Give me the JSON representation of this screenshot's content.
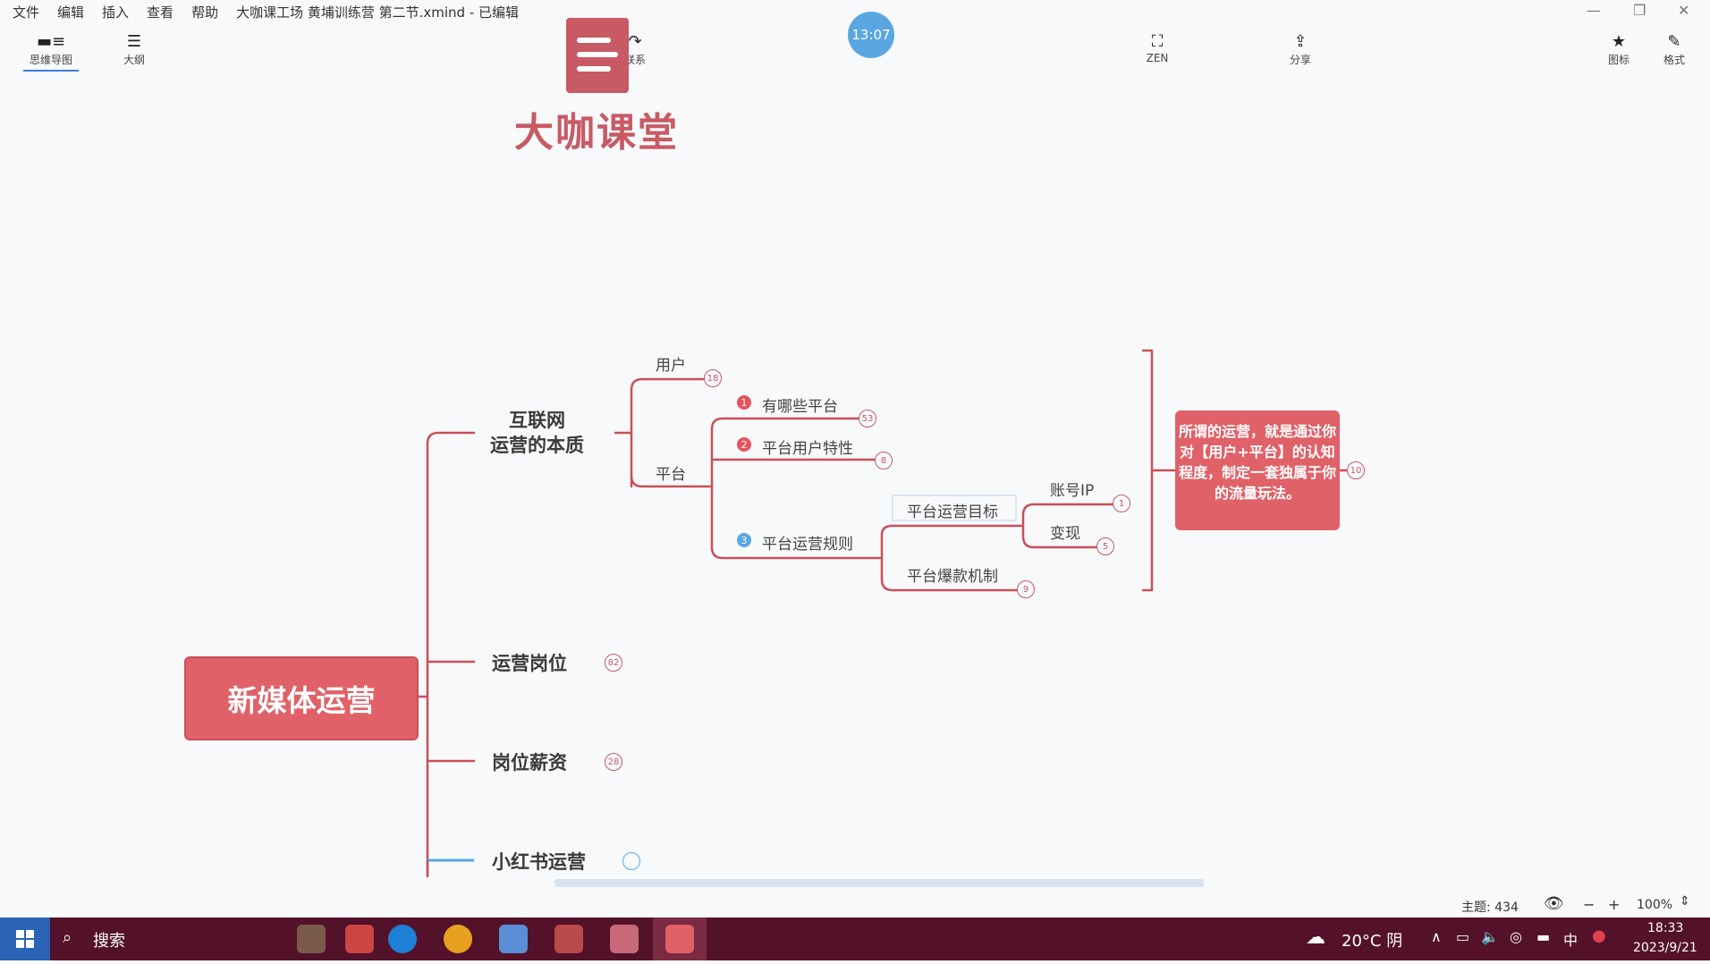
{
  "menubar": {
    "items": [
      "文件",
      "编辑",
      "插入",
      "查看",
      "帮助"
    ],
    "window_title": "大咖课工场 黄埔训练营 第二节.xmind - 已编辑"
  },
  "toolbar": {
    "mindmap_label": "思维导图",
    "outline_label": "大纲",
    "relation_label": "联系",
    "zen_label": "ZEN",
    "share_label": "分享",
    "icon_label": "图标",
    "format_label": "格式",
    "timer": "13:07"
  },
  "watermark": {
    "text": "大咖课堂"
  },
  "map": {
    "central": "新媒体运营",
    "main1_line1": "互联网",
    "main1_line2": "运营的本质",
    "user": "用户",
    "user_badge": "18",
    "platform": "平台",
    "p1": "有哪些平台",
    "p1_num": "1",
    "p1_badge": "53",
    "p2": "平台用户特性",
    "p2_num": "2",
    "p2_badge": "8",
    "p3": "平台运营规则",
    "p3_num": "3",
    "r1": "平台运营目标",
    "r1a": "账号IP",
    "r1a_badge": "1",
    "r1b": "变现",
    "r1b_badge": "5",
    "r2": "平台爆款机制",
    "r2_badge": "9",
    "callout": "所谓的运营，就是通过你对【用户+平台】的认知程度，制定一套独属于你的流量玩法。",
    "callout_badge": "10",
    "main2": "运营岗位",
    "main2_badge": "82",
    "main3": "岗位薪资",
    "main3_badge": "28",
    "main4": "小红书运营"
  },
  "status": {
    "topics": "主题: 434",
    "zoom": "100%",
    "minus": "−",
    "plus": "+"
  },
  "taskbar": {
    "search": "搜索",
    "weather": "20°C 阴",
    "ime": "中",
    "time": "18:33",
    "date": "2023/9/21"
  },
  "colors": {
    "branch": "#c95058",
    "accent": "#e06168",
    "taskbar": "#53112a",
    "timer": "#5aa6e2"
  }
}
